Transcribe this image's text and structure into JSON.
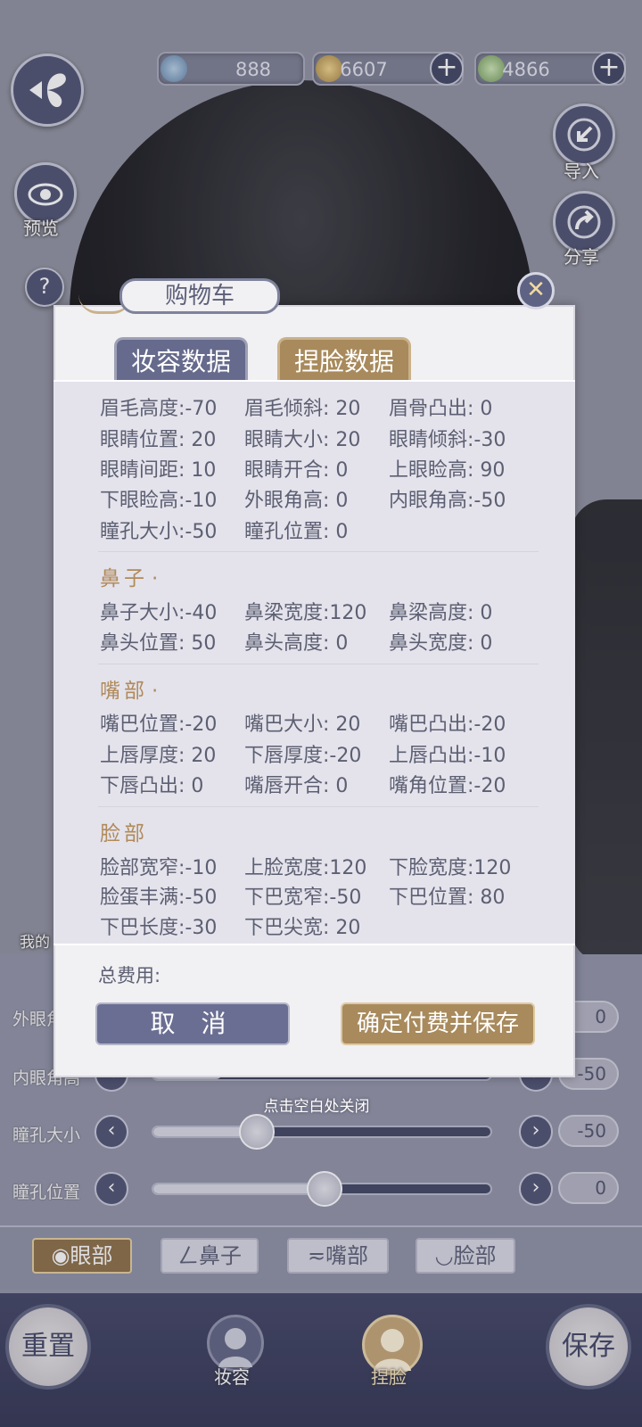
{
  "currency": [
    {
      "value": "888",
      "has_plus": false
    },
    {
      "value": "6607",
      "has_plus": true
    },
    {
      "value": "4866",
      "has_plus": true
    }
  ],
  "side_buttons": {
    "preview": "预览",
    "import": "导入",
    "share": "分享",
    "help": "?",
    "my_label": "我的"
  },
  "modal": {
    "title": "购物车",
    "tab_makeup": "妆容数据",
    "tab_face": "捏脸数据",
    "eyes_rows": [
      [
        "眉毛高度:-70",
        "眉毛倾斜: 20",
        "眉骨凸出:  0"
      ],
      [
        "眼睛位置: 20",
        "眼睛大小: 20",
        "眼睛倾斜:-30"
      ],
      [
        "眼睛间距: 10",
        "眼睛开合:  0",
        "上眼睑高: 90"
      ],
      [
        "下眼睑高:-10",
        "外眼角高:  0",
        "内眼角高:-50"
      ],
      [
        "瞳孔大小:-50",
        "瞳孔位置:  0",
        ""
      ]
    ],
    "nose_title": "鼻子",
    "nose_rows": [
      [
        "鼻子大小:-40",
        "鼻梁宽度:120",
        "鼻梁高度:  0"
      ],
      [
        "鼻头位置: 50",
        "鼻头高度:  0",
        "鼻头宽度:  0"
      ]
    ],
    "mouth_title": "嘴部",
    "mouth_rows": [
      [
        "嘴巴位置:-20",
        "嘴巴大小: 20",
        "嘴巴凸出:-20"
      ],
      [
        "上唇厚度: 20",
        "下唇厚度:-20",
        "上唇凸出:-10"
      ],
      [
        "下唇凸出:  0",
        "嘴唇开合:  0",
        "嘴角位置:-20"
      ]
    ],
    "face_title": "脸部",
    "face_rows": [
      [
        "脸部宽窄:-10",
        "上脸宽度:120",
        "下脸宽度:120"
      ],
      [
        "脸蛋丰满:-50",
        "下巴宽窄:-50",
        "下巴位置: 80"
      ],
      [
        "下巴长度:-30",
        "下巴尖宽: 20",
        ""
      ]
    ],
    "total_cost_label": "总费用:",
    "cancel_label": "取 消",
    "confirm_label": "确定付费并保存"
  },
  "hint": "点击空白处关闭",
  "sliders": [
    {
      "label": "外眼角高",
      "value": "0",
      "level": 0.5
    },
    {
      "label": "内眼角高",
      "value": "-50",
      "level": 0.2
    },
    {
      "label": "瞳孔大小",
      "value": "-50",
      "level": 0.3
    },
    {
      "label": "瞳孔位置",
      "value": "0",
      "level": 0.5
    }
  ],
  "categories": [
    {
      "label": "眼部",
      "active": true,
      "icon": "eye-icon"
    },
    {
      "label": "鼻子",
      "active": false,
      "icon": "nose-icon"
    },
    {
      "label": "嘴部",
      "active": false,
      "icon": "mouth-icon"
    },
    {
      "label": "脸部",
      "active": false,
      "icon": "face-icon"
    }
  ],
  "bottom": {
    "reset": "重置",
    "makeup": "妆容",
    "pinch": "捏脸",
    "save": "保存"
  },
  "colors": {
    "accent_gold": "#a88a5c",
    "accent_purple": "#6a6e92"
  }
}
